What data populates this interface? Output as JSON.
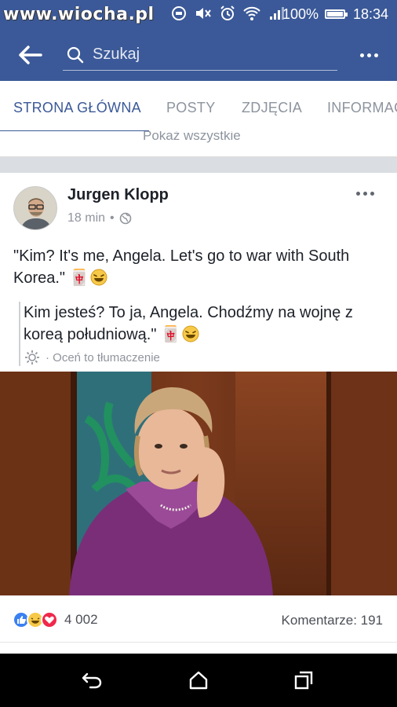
{
  "watermark": "www.wiocha.pl",
  "status_bar": {
    "battery": "100%",
    "time": "18:34"
  },
  "app_bar": {
    "search_placeholder": "Szukaj"
  },
  "tabs": [
    {
      "label": "STRONA GŁÓWNA",
      "active": true
    },
    {
      "label": "POSTY",
      "active": false
    },
    {
      "label": "ZDJĘCIA",
      "active": false
    },
    {
      "label": "INFORMAC",
      "active": false
    }
  ],
  "show_all_label": "Pokaż wszystkie",
  "post": {
    "author": "Jurgen Klopp",
    "time": "18 min",
    "separator": "•",
    "text": "\"Kim? It's me, Angela. Let's go to war with South Korea.\" 🀄",
    "translation": "Kim jesteś? To ja, Angela. Chodźmy na wojnę z koreą południową.\" 🀄",
    "rate_translation": "· Oceń to tłumaczenie",
    "reaction_count": "4 002",
    "comments": "Komentarze: 191"
  },
  "colors": {
    "brand": "#3b5998",
    "text": "#1d2129",
    "muted": "#90949c",
    "tab_inactive": "#8d949e"
  }
}
